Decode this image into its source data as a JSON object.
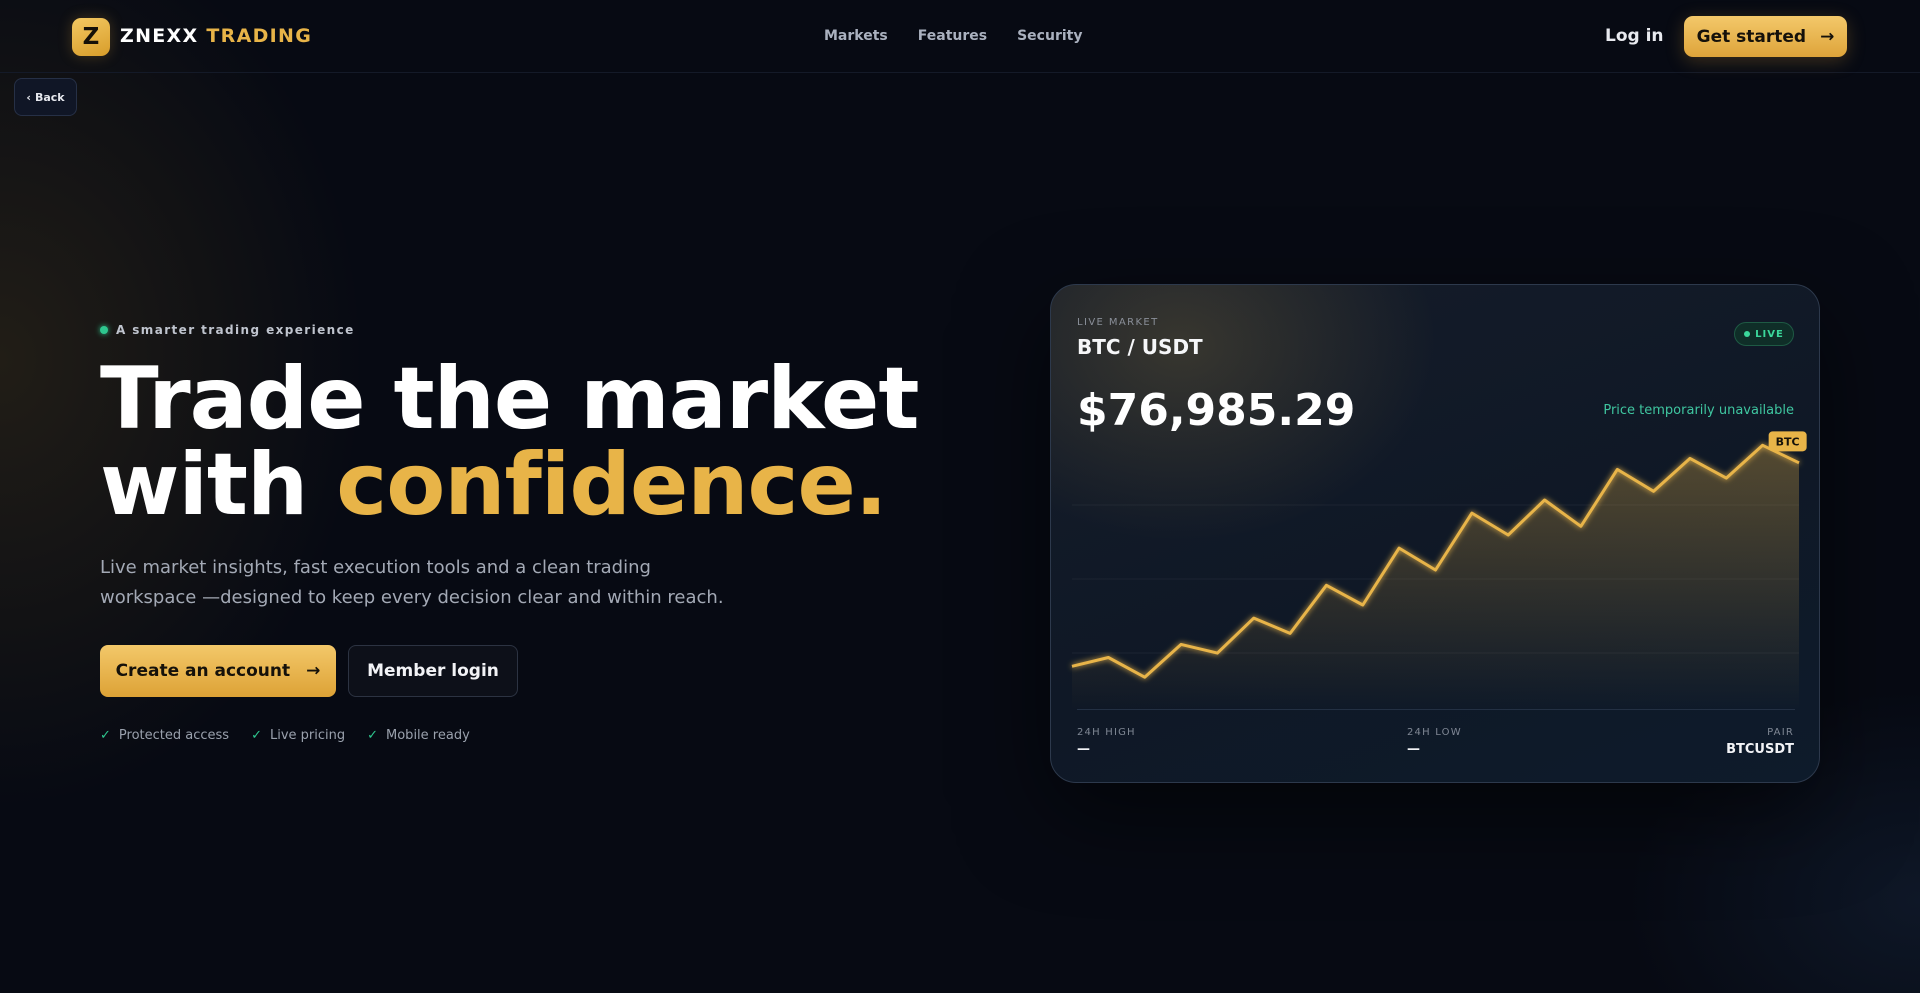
{
  "header": {
    "logo_letter": "Z",
    "brand_primary": "ZNEXX",
    "brand_secondary": "TRADING",
    "nav": [
      "Markets",
      "Features",
      "Security"
    ],
    "login_label": "Log in",
    "get_started_label": "Get started",
    "get_started_arrow": "→"
  },
  "back": {
    "chevron": "‹",
    "label": "Back"
  },
  "hero": {
    "eyebrow": "A smarter trading experience",
    "title_line1": "Trade the market",
    "title_line2_plain": "with",
    "title_line2_accent": "confidence.",
    "subtitle": "Live market insights, fast execution tools and a clean trading workspace —designed to keep every decision clear and within reach.",
    "primary_cta": "Create an account",
    "primary_cta_arrow": "→",
    "secondary_cta": "Member login",
    "check_glyph": "✓",
    "features": [
      "Protected access",
      "Live pricing",
      "Mobile ready"
    ]
  },
  "market_card": {
    "eyebrow": "LIVE MARKET",
    "pair": "BTC / USDT",
    "live_label": "LIVE",
    "price": "$76,985.29",
    "status": "Price temporarily unavailable",
    "high_label": "24H HIGH",
    "high_value": "—",
    "low_label": "24H LOW",
    "low_value": "—",
    "pair_label": "PAIR",
    "pair_value": "BTCUSDT"
  },
  "colors": {
    "accent": "#e8b448",
    "background": "#070a13",
    "live_green": "#2ec78f",
    "status_teal": "#3fc6a0"
  },
  "chart_data": {
    "type": "area",
    "title": "",
    "xlabel": "",
    "ylabel": "",
    "series": [
      {
        "name": "BTC",
        "values": [
          10,
          14,
          5,
          20,
          16,
          32,
          25,
          47,
          38,
          64,
          54,
          80,
          70,
          86,
          74,
          100,
          90,
          105,
          96,
          111,
          103
        ]
      }
    ],
    "grid": true,
    "ylim": [
      -10,
      118
    ]
  }
}
